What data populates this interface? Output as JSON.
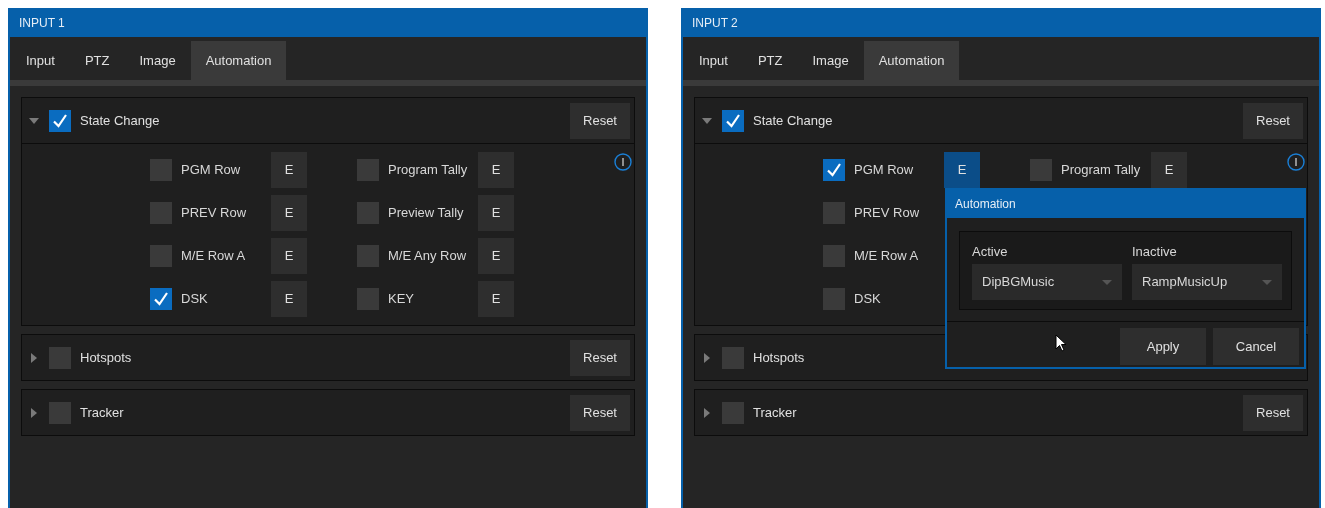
{
  "panels": [
    {
      "title": "INPUT 1",
      "tabs": [
        {
          "label": "Input",
          "selected": false
        },
        {
          "label": "PTZ",
          "selected": false
        },
        {
          "label": "Image",
          "selected": false
        },
        {
          "label": "Automation",
          "selected": true
        }
      ],
      "sections": [
        {
          "label": "State Change",
          "expanded": true,
          "checked": true,
          "reset": "Reset",
          "info": true,
          "columns": [
            [
              {
                "label": "PGM Row",
                "checked": false,
                "edit": {
                  "label": "E",
                  "selected": false
                }
              },
              {
                "label": "PREV Row",
                "checked": false,
                "edit": {
                  "label": "E",
                  "selected": false
                }
              },
              {
                "label": "M/E Row A",
                "checked": false,
                "edit": {
                  "label": "E",
                  "selected": false
                }
              },
              {
                "label": "DSK",
                "checked": true,
                "edit": {
                  "label": "E",
                  "selected": false
                }
              }
            ],
            [
              {
                "label": "Program Tally",
                "checked": false,
                "edit": {
                  "label": "E",
                  "selected": false
                }
              },
              {
                "label": "Preview Tally",
                "checked": false,
                "edit": {
                  "label": "E",
                  "selected": false
                }
              },
              {
                "label": "M/E Any Row",
                "checked": false,
                "edit": {
                  "label": "E",
                  "selected": false
                }
              },
              {
                "label": "KEY",
                "checked": false,
                "edit": {
                  "label": "E",
                  "selected": false
                }
              }
            ]
          ]
        },
        {
          "label": "Hotspots",
          "expanded": false,
          "checked": false,
          "reset": "Reset"
        },
        {
          "label": "Tracker",
          "expanded": false,
          "checked": false,
          "reset": "Reset"
        }
      ]
    },
    {
      "title": "INPUT 2",
      "tabs": [
        {
          "label": "Input",
          "selected": false
        },
        {
          "label": "PTZ",
          "selected": false
        },
        {
          "label": "Image",
          "selected": false
        },
        {
          "label": "Automation",
          "selected": true
        }
      ],
      "sections": [
        {
          "label": "State Change",
          "expanded": true,
          "checked": true,
          "reset": "Reset",
          "info": true,
          "columns": [
            [
              {
                "label": "PGM Row",
                "checked": true,
                "edit": {
                  "label": "E",
                  "selected": true
                }
              },
              {
                "label": "PREV Row",
                "checked": false
              },
              {
                "label": "M/E Row A",
                "checked": false
              },
              {
                "label": "DSK",
                "checked": false
              }
            ],
            [
              {
                "label": "Program Tally",
                "checked": false,
                "edit": {
                  "label": "E",
                  "selected": false
                }
              }
            ]
          ]
        },
        {
          "label": "Hotspots",
          "expanded": false,
          "checked": false
        },
        {
          "label": "Tracker",
          "expanded": false,
          "checked": false,
          "reset": "Reset"
        }
      ],
      "popup": {
        "title": "Automation",
        "fields": [
          {
            "label": "Active",
            "value": "DipBGMusic"
          },
          {
            "label": "Inactive",
            "value": "RampMusicUp"
          }
        ],
        "buttons": [
          "Apply",
          "Cancel"
        ]
      }
    }
  ]
}
